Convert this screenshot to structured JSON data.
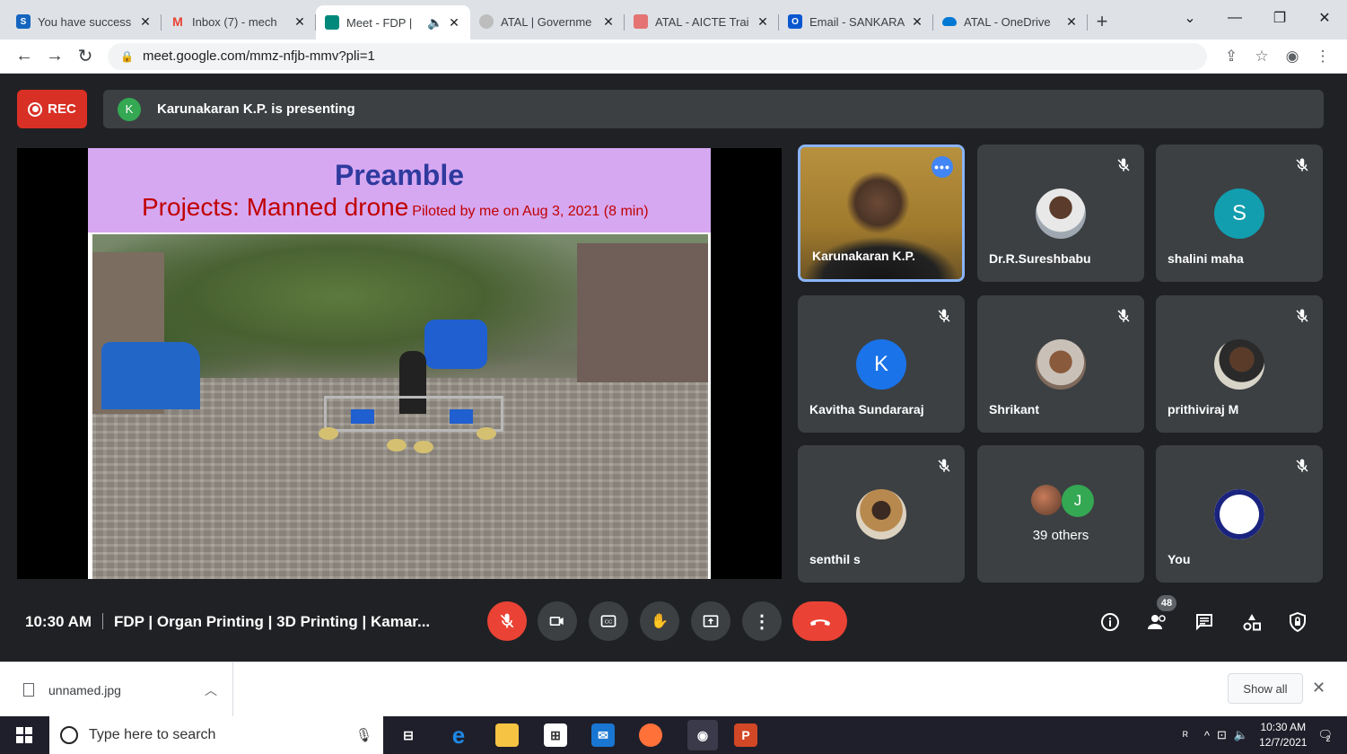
{
  "browser": {
    "tabs": [
      {
        "title": "You have success",
        "fav_letter": "S",
        "fav_color": "#1565c0"
      },
      {
        "title": "Inbox (7) - mech",
        "fav_letter": "M",
        "fav_color": "#ea4335"
      },
      {
        "title": "Meet - FDP |",
        "fav_letter": "",
        "fav_color": "#00897b"
      },
      {
        "title": "ATAL | Governme",
        "fav_letter": "",
        "fav_color": "#9e9e9e"
      },
      {
        "title": "ATAL - AICTE Trai",
        "fav_letter": "",
        "fav_color": "#c62828"
      },
      {
        "title": "Email - SANKARA",
        "fav_letter": "O",
        "fav_color": "#0b57d0"
      },
      {
        "title": "ATAL - OneDrive",
        "fav_letter": "",
        "fav_color": "#0078d4"
      }
    ],
    "url": "meet.google.com/mmz-nfjb-mmv?pli=1"
  },
  "meet": {
    "rec_label": "REC",
    "presenter_initial": "K",
    "presenting_text": "Karunakaran K.P. is presenting",
    "slide": {
      "title": "Preamble",
      "subtitle": "Projects: Manned drone",
      "subtitle_small": "Piloted by me on Aug 3, 2021 (8 min)"
    },
    "tiles": [
      {
        "name": "Karunakaran K.P."
      },
      {
        "name": "Dr.R.Sureshbabu"
      },
      {
        "name": "shalini maha",
        "initial": "S",
        "color": "#129eaf"
      },
      {
        "name": "Kavitha Sundararaj",
        "initial": "K",
        "color": "#1a73e8"
      },
      {
        "name": "Shrikant"
      },
      {
        "name": "prithiviraj M"
      },
      {
        "name": "senthil s"
      },
      {
        "name": "39 others",
        "initial": "J"
      },
      {
        "name": "You"
      }
    ],
    "time": "10:30 AM",
    "meeting_title": "FDP | Organ Printing | 3D Printing | Kamar...",
    "people_count": "48"
  },
  "downloads": {
    "file": "unnamed.jpg",
    "show_all": "Show all"
  },
  "taskbar": {
    "search_placeholder": "Type here to search",
    "time": "10:30 AM",
    "date": "12/7/2021",
    "notif_count": "2"
  }
}
